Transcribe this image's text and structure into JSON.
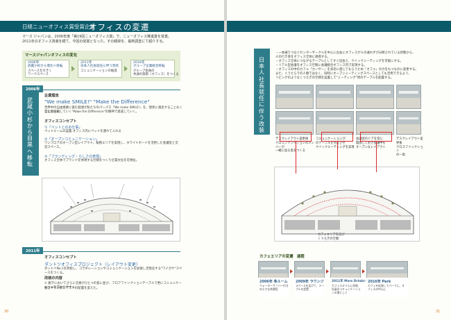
{
  "header": {
    "kicker": "日経ニューオフィス賞受賞企業",
    "title": "オフィスの変遷"
  },
  "intro": {
    "line1": "マース ジャパンは、2006年度「第19回ニューオフィス賞」で、ニューオフィス推進賞を受賞。",
    "line2": "2011年のオフィス改装を経て、今回の受賞となった。その経緯を、最新調査にて紹介する。"
  },
  "history_panel": {
    "title": "マースジャパンオフィスの変化",
    "eras": [
      {
        "year": "2006年",
        "place": "武蔵小杉から恵比へ移転",
        "desc1": "スペースを大きく",
        "desc2": "ワークスペース"
      },
      {
        "year": "2011年",
        "place": "日本人社長就任に伴う改装",
        "desc1": "コミュニケーションの推進",
        "desc2": ""
      },
      {
        "year": "2016年",
        "place": "グループ企業統合移転",
        "desc1": "グループ会員の",
        "desc2": "共通の施策（オフィス）をつくる"
      }
    ]
  },
  "section_2006": {
    "year_tab": "2006年",
    "vertical": "武蔵小杉から目黒へ移転",
    "philosophy_label": "企業理念",
    "philosophy_quote": "\"We make SMILE!\"  \"Make the Difference\"",
    "philosophy_desc1": "世界中の自由要素に富む発想が私たちのパーパス『We make SMILE!』を、現状に満足することなく常に新しい",
    "philosophy_desc2": "ことに挑戦していく\"Make the Difference\"の精神で達成していく。",
    "concept_label": "オフィスコンセプト",
    "concepts": [
      {
        "title": "①「ペットとのお仕事」",
        "desc": "ペットルームの設置 オフィス内にペットを連れて入れる"
      },
      {
        "title": "②「オープンコミュニケーション」",
        "desc": "ワンフロアのオープン型レイアウト。執務エリアを実現し、ホワイトボードを活用した会議室と交流スペース。"
      },
      {
        "title": "③「ブランディング・らしさの表現」",
        "desc": "オフィス全体でブランドを体現する空間をつくり企業文化を可視化。"
      }
    ]
  },
  "section_2011": {
    "year_tab": "2011年",
    "concept_label": "オフィスコンセプト",
    "project_title": "ダントツオフィスプロジェクト（レイアウト変更）",
    "project_desc": "ダントツNo.1を目指し、コラボレーションやコミュニケーションを加速し活性化する\"ワイガヤ\"スペースをつくる。",
    "content_label": "改装の内容",
    "content_desc1": "① 廊下においてさらに全員がひとつの島に並び、フロアファンクションテーブルで更にコミュニケーションを交わりやすく、",
    "content_desc2": "  働きやすい形にデスクの配置を変えた。"
  },
  "right_section": {
    "vertical": "日本人社長就任に伴う改装",
    "bullets": [
      "・一本通りつなぐセンターサークルを中心に左右にオフィスが人の通れずが分断されている状態から、",
      "  人の行き来をオフィス全体に誘導する。",
      "・オフィス全体につながるテーブルとしてすぐ出会え、クイックミーティングを可能にする。",
      "・リアル型会議をオフィス空間に会議統合オフィス内で実現する。",
      "・オフィスの中のカフェ「カーサー」を身近に感じてもらうため「カフェ」の力をもつものに変更する。",
      "  また、ぐうたらでの人間ではなく、同時にオープンミーティングスペースとしても活用できるよう、",
      "  リビングのようなくつろぎの空間を設置して\"ミーティング\"用のテーブルを配置する。"
    ],
    "captions": [
      "デスクレイアウト変更後\nクロスファンクションのメンバーが\n一緒に居る島をつくる",
      "コミュニケーションが\nのテーブルを点在させ\nクイックミーティングを実現",
      "会議室のドアを常に\n開放しておき会議中も\nオープンなレイアウト",
      "デスクレイアウト変更後\nクロスファンクション\nの一角",
      "カフェエリアを広げ\nくつろぎの空間"
    ]
  },
  "cafe": {
    "label": "カフェエリアの変遷　過程",
    "items": [
      {
        "title": "2006年 条ルーム",
        "desc": "ウォーターサーバー付きの小さな休憩室"
      },
      {
        "title": "2009年 ラウンジ",
        "desc": "スペースを広げて、テーブルを設置"
      },
      {
        "title": "2011年 Mars Drinks Cafe",
        "desc": "カフェスタイルに改装、社員のコミュニケーションの場として"
      },
      {
        "title": "2016年 Park",
        "desc": "カフェを拡張してパークに。オフィスの中心に"
      }
    ]
  },
  "pages": {
    "left": "30",
    "right": "31"
  }
}
